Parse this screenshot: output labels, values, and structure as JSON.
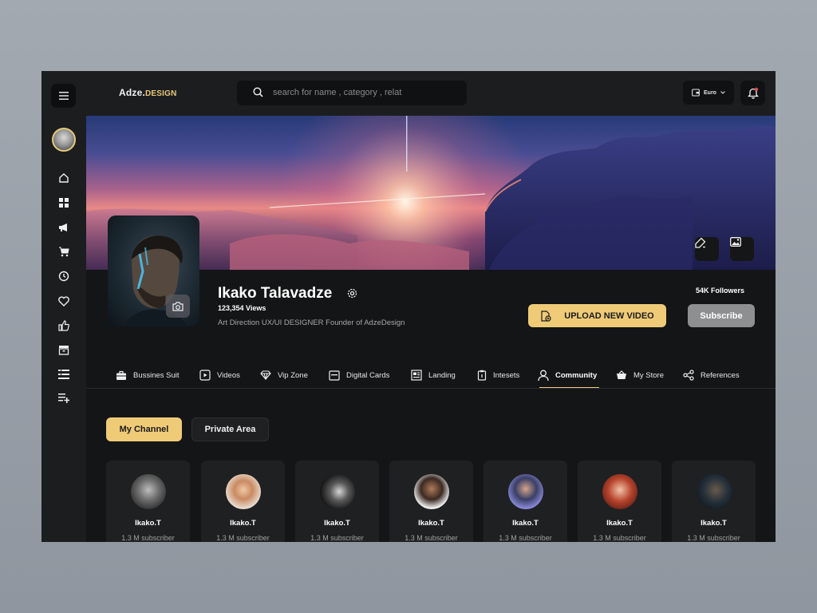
{
  "brand": {
    "name": "Adze.",
    "accent": "DESIGN"
  },
  "search": {
    "placeholder": "search for name , category , relat"
  },
  "currency": {
    "label": "Euro"
  },
  "sidebar": {
    "icons": [
      "home-icon",
      "grid-icon",
      "megaphone-icon",
      "cart-icon",
      "clock-icon",
      "heart-icon",
      "thumbs-up-icon",
      "box-icon",
      "list-icon",
      "playlist-add-icon"
    ]
  },
  "profile": {
    "name": "Ikako Talavadze",
    "views": "123,354 Views",
    "bio": "Art Direction UX/UI DESIGNER Founder of AdzeDesign",
    "followers": "54K Followers"
  },
  "actions": {
    "upload": "UPLOAD NEW VIDEO",
    "subscribe": "Subscribe"
  },
  "tabs": [
    {
      "label": "Bussines Suit",
      "icon": "briefcase-icon"
    },
    {
      "label": "Videos",
      "icon": "video-icon"
    },
    {
      "label": "Vip Zone",
      "icon": "diamond-icon"
    },
    {
      "label": "Digital Cards",
      "icon": "card-icon"
    },
    {
      "label": "Landing",
      "icon": "layout-icon"
    },
    {
      "label": "Intesets",
      "icon": "clipboard-icon"
    },
    {
      "label": "Community",
      "icon": "user-icon",
      "active": true
    },
    {
      "label": "My Store",
      "icon": "basket-icon"
    },
    {
      "label": "References",
      "icon": "share-icon"
    }
  ],
  "channel": {
    "my": "My Channel",
    "private": "Private Area"
  },
  "cards": [
    {
      "name": "Ikako.T",
      "sub": "1.3 M subscriber"
    },
    {
      "name": "Ikako.T",
      "sub": "1.3 M subscriber"
    },
    {
      "name": "Ikako.T",
      "sub": "1.3 M subscriber"
    },
    {
      "name": "Ikako.T",
      "sub": "1.3 M subscriber"
    },
    {
      "name": "Ikako.T",
      "sub": "1.3 M subscriber"
    },
    {
      "name": "Ikako.T",
      "sub": "1.3 M subscriber"
    },
    {
      "name": "Ikako.T",
      "sub": "1.3 M subscriber"
    }
  ],
  "colors": {
    "accent": "#efcb78",
    "background": "#141516",
    "panel": "#1f2022"
  }
}
